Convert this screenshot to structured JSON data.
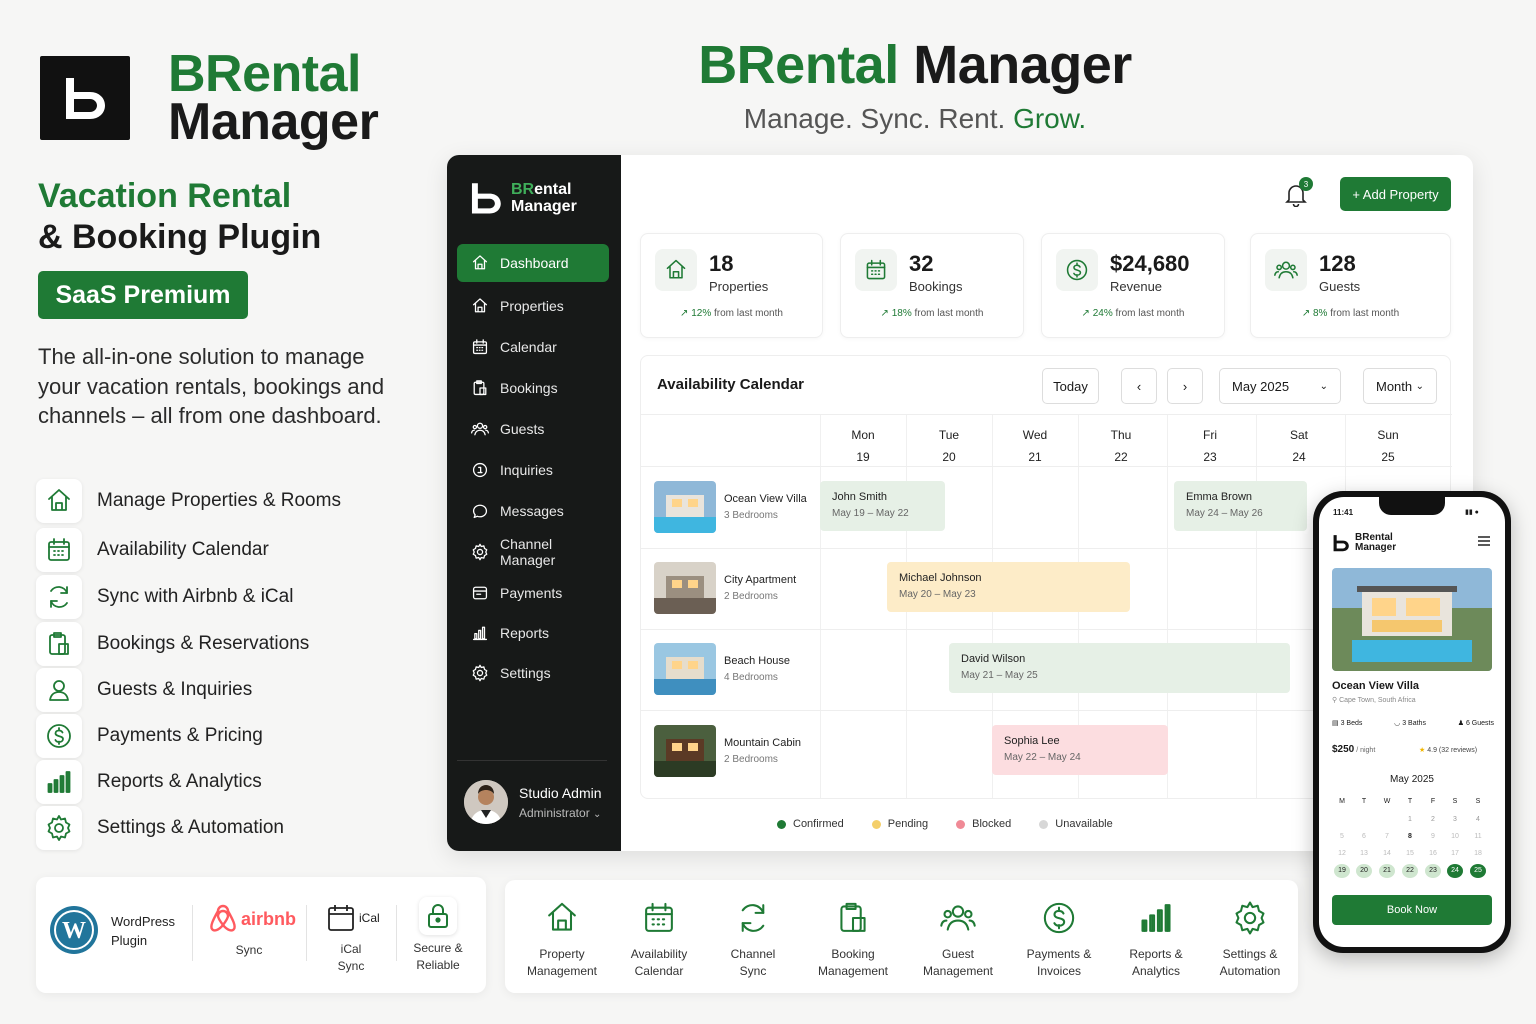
{
  "brand": {
    "part1": "BRental",
    "part2": "Manager",
    "line2": "Manager",
    "hero_first": "BRental",
    "hero_second": " Manager"
  },
  "hero": {
    "sub1": "Manage. Sync. Rent. ",
    "sub2": "Grow."
  },
  "tagline": {
    "line1": "Vacation Rental",
    "line2": "& Booking Plugin"
  },
  "badge": "SaaS Premium",
  "description": "The all-in-one solution to manage your vacation rentals, bookings and channels – all from one dashboard.",
  "features": [
    {
      "label": "Manage Properties & Rooms",
      "icon": "home-icon"
    },
    {
      "label": "Availability Calendar",
      "icon": "calendar-icon"
    },
    {
      "label": "Sync with Airbnb & iCal",
      "icon": "sync-icon"
    },
    {
      "label": "Bookings & Reservations",
      "icon": "booking-icon"
    },
    {
      "label": "Guests & Inquiries",
      "icon": "user-icon"
    },
    {
      "label": "Payments & Pricing",
      "icon": "dollar-icon"
    },
    {
      "label": "Reports & Analytics",
      "icon": "chart-icon"
    },
    {
      "label": "Settings & Automation",
      "icon": "gear-icon"
    }
  ],
  "sidebar": {
    "brand1": "BR",
    "brand1b": "ental",
    "brand2": "Manager",
    "items": [
      {
        "label": "Dashboard"
      },
      {
        "label": "Properties"
      },
      {
        "label": "Calendar"
      },
      {
        "label": "Bookings"
      },
      {
        "label": "Guests"
      },
      {
        "label": "Inquiries"
      },
      {
        "label": "Messages"
      },
      {
        "label": "Channel Manager"
      },
      {
        "label": "Payments"
      },
      {
        "label": "Reports"
      },
      {
        "label": "Settings"
      }
    ],
    "user": {
      "name": "Studio Admin",
      "role": "Administrator"
    }
  },
  "topbar": {
    "notifications": "3",
    "add_label": "+ Add Property"
  },
  "stats": [
    {
      "value": "18",
      "label": "Properties",
      "change": "12%",
      "suffix": " from last month"
    },
    {
      "value": "32",
      "label": "Bookings",
      "change": "18%",
      "suffix": " from last month"
    },
    {
      "value": "$24,680",
      "label": "Revenue",
      "change": "24%",
      "suffix": " from last month"
    },
    {
      "value": "128",
      "label": "Guests",
      "change": "8%",
      "suffix": " from last month"
    }
  ],
  "calendar": {
    "title": "Availability Calendar",
    "today": "Today",
    "month": "May 2025",
    "view": "Month",
    "days": [
      {
        "d": "Mon",
        "n": "19"
      },
      {
        "d": "Tue",
        "n": "20"
      },
      {
        "d": "Wed",
        "n": "21"
      },
      {
        "d": "Thu",
        "n": "22"
      },
      {
        "d": "Fri",
        "n": "23"
      },
      {
        "d": "Sat",
        "n": "24"
      },
      {
        "d": "Sun",
        "n": "25"
      }
    ],
    "properties": [
      {
        "name": "Ocean View Villa",
        "beds": "3 Bedrooms"
      },
      {
        "name": "City Apartment",
        "beds": "2 Bedrooms"
      },
      {
        "name": "Beach House",
        "beds": "4 Bedrooms"
      },
      {
        "name": "Mountain Cabin",
        "beds": "2 Bedrooms"
      }
    ],
    "bookings": [
      {
        "guest": "John Smith",
        "dates": "May 19 – May 22",
        "status": "confirmed"
      },
      {
        "guest": "Emma Brown",
        "dates": "May 24 – May 26",
        "status": "confirmed"
      },
      {
        "guest": "Michael Johnson",
        "dates": "May 20 – May 23",
        "status": "pending"
      },
      {
        "guest": "David Wilson",
        "dates": "May 21 – May 25",
        "status": "confirmed"
      },
      {
        "guest": "Sophia Lee",
        "dates": "May 22 – May 24",
        "status": "blocked"
      }
    ],
    "legend": [
      {
        "label": "Confirmed",
        "color": "#1f7a35"
      },
      {
        "label": "Pending",
        "color": "#f4cf6a"
      },
      {
        "label": "Blocked",
        "color": "#f08a96"
      },
      {
        "label": "Unavailable",
        "color": "#d7d7d7"
      }
    ]
  },
  "phone": {
    "time": "11:41",
    "brand1": "BRental",
    "brand2": "Manager",
    "property": "Ocean View Villa",
    "location": "Cape Town, South Africa",
    "beds": "3 Beds",
    "baths": "3 Baths",
    "guests": "6 Guests",
    "price": "$250",
    "per": " / night",
    "rating": "4.9 (32 reviews)",
    "month": "May 2025",
    "weekdays": [
      "M",
      "T",
      "W",
      "T",
      "F",
      "S",
      "S"
    ],
    "grid": [
      [
        "",
        "",
        "",
        "1",
        "2",
        "3",
        "4"
      ],
      [
        "5",
        "6",
        "7",
        "8",
        "9",
        "10",
        "11"
      ],
      [
        "12",
        "13",
        "14",
        "15",
        "16",
        "17",
        "18"
      ],
      [
        "19",
        "20",
        "21",
        "22",
        "23",
        "24",
        "25"
      ]
    ],
    "book": "Book Now"
  },
  "integrations": [
    {
      "l1": "WordPress",
      "l2": "Plugin"
    },
    {
      "l1": "airbnb",
      "l2": "Sync"
    },
    {
      "l1": "iCal",
      "l2": "iCal",
      "l3": "Sync"
    },
    {
      "l1": "Secure &",
      "l2": "Reliable"
    }
  ],
  "modules": [
    {
      "l1": "Property",
      "l2": "Management"
    },
    {
      "l1": "Availability",
      "l2": "Calendar"
    },
    {
      "l1": "Channel",
      "l2": "Sync"
    },
    {
      "l1": "Booking",
      "l2": "Management"
    },
    {
      "l1": "Guest",
      "l2": "Management"
    },
    {
      "l1": "Payments &",
      "l2": "Invoices"
    },
    {
      "l1": "Reports &",
      "l2": "Analytics"
    },
    {
      "l1": "Settings &",
      "l2": "Automation"
    }
  ]
}
